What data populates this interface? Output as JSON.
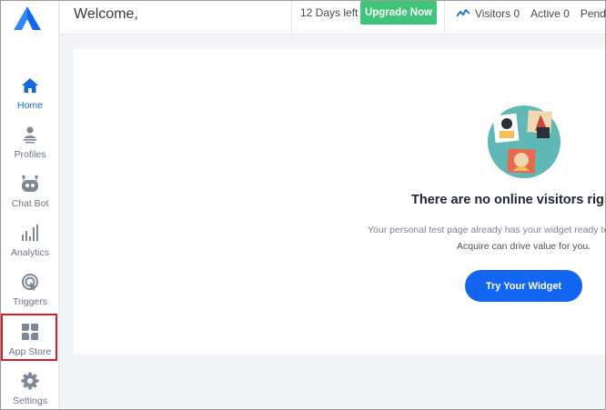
{
  "header": {
    "welcome": "Welcome,",
    "days_left": "12 Days left",
    "upgrade_label": "Upgrade Now",
    "visitors": "Visitors 0",
    "active": "Active 0",
    "pending": "Pendin"
  },
  "sidebar": {
    "items": [
      {
        "label": "Home",
        "icon": "home-icon"
      },
      {
        "label": "Profiles",
        "icon": "profiles-icon"
      },
      {
        "label": "Chat Bot",
        "icon": "chatbot-icon"
      },
      {
        "label": "Analytics",
        "icon": "analytics-icon"
      },
      {
        "label": "Triggers",
        "icon": "triggers-icon"
      },
      {
        "label": "App Store",
        "icon": "app-store-icon"
      },
      {
        "label": "Settings",
        "icon": "settings-icon"
      }
    ]
  },
  "main": {
    "empty_title": "There are no online visitors right",
    "empty_line1": "Your personal test page already has your widget ready to",
    "empty_line2": "Acquire can drive value for you.",
    "cta_label": "Try Your Widget"
  },
  "colors": {
    "accent": "#1466f2",
    "upgrade": "#3ec57a",
    "highlight": "#d6202a"
  }
}
